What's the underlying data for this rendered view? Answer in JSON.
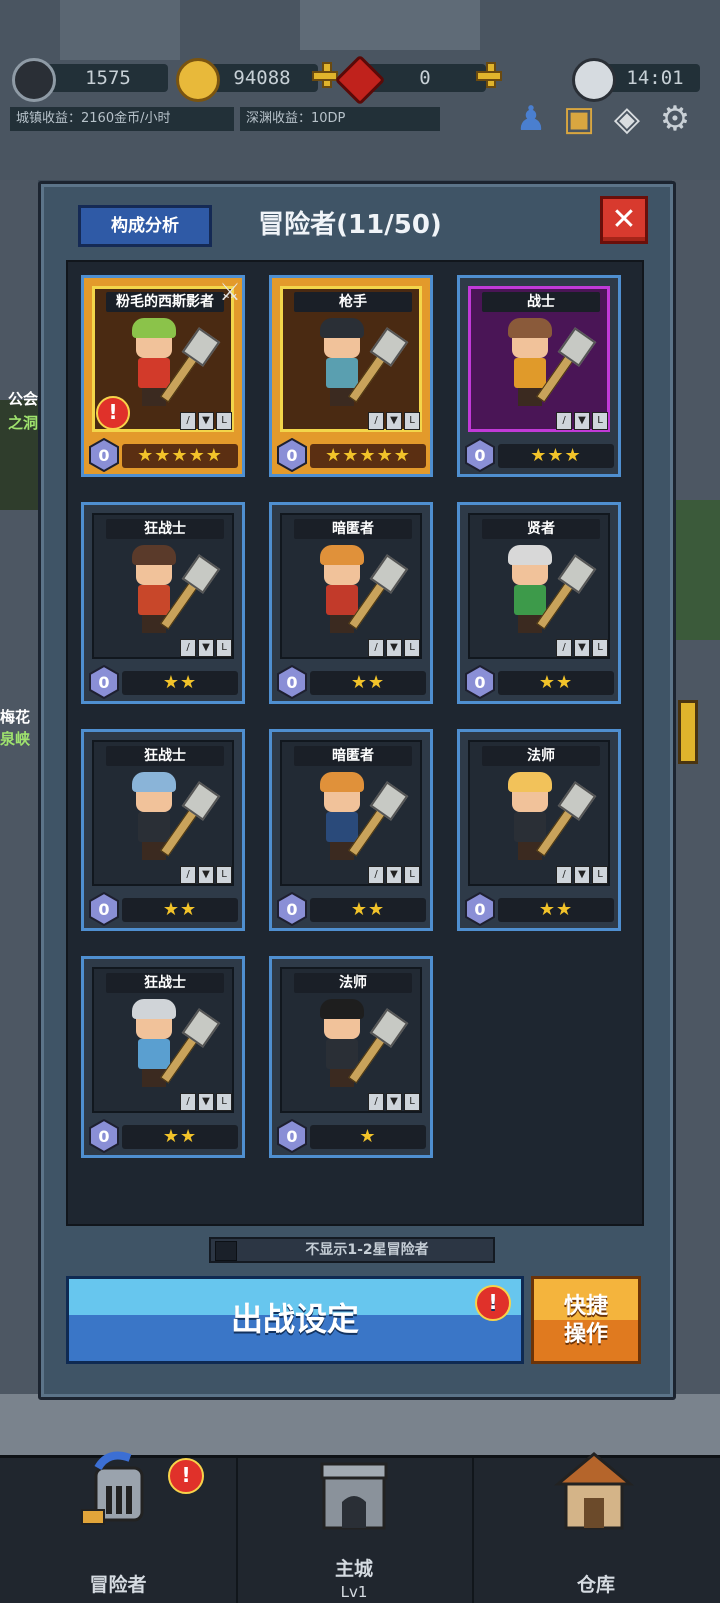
{
  "topbar": {
    "stamina_value": "1575",
    "gold_value": "94088",
    "gem_value": "0",
    "clock_value": "14:01",
    "town_income": "城镇收益：2160金币/小时",
    "abyss_income": "深渊收益：10DP"
  },
  "panel": {
    "analysis_label": "构成分析",
    "title": "冒险者(11/50)",
    "close_label": "✕"
  },
  "cards": [
    {
      "name": "粉毛的西斯影者",
      "stars": "★★★★★",
      "level": "0",
      "style": "gold"
    },
    {
      "name": "枪手",
      "stars": "★★★★★",
      "level": "0",
      "style": "gold"
    },
    {
      "name": "战士",
      "stars": "★★★",
      "level": "0",
      "style": "purple"
    },
    {
      "name": "狂战士",
      "stars": "★★",
      "level": "0",
      "style": "normal"
    },
    {
      "name": "暗匿者",
      "stars": "★★",
      "level": "0",
      "style": "normal"
    },
    {
      "name": "贤者",
      "stars": "★★",
      "level": "0",
      "style": "normal"
    },
    {
      "name": "狂战士",
      "stars": "★★",
      "level": "0",
      "style": "normal"
    },
    {
      "name": "暗匿者",
      "stars": "★★",
      "level": "0",
      "style": "normal"
    },
    {
      "name": "法师",
      "stars": "★★",
      "level": "0",
      "style": "normal"
    },
    {
      "name": "狂战士",
      "stars": "★★",
      "level": "0",
      "style": "normal"
    },
    {
      "name": "法师",
      "stars": "★",
      "level": "0",
      "style": "normal"
    }
  ],
  "filter": {
    "label": "不显示1-2星冒险者"
  },
  "buttons": {
    "battle_label": "出战设定",
    "quick_label_1": "快捷",
    "quick_label_2": "操作",
    "alert_glyph": "!"
  },
  "nav": {
    "adventurer": "冒险者",
    "main_city": "主城",
    "main_city_level": "Lv1",
    "warehouse": "仓库"
  },
  "side_labels": {
    "guild": "公会",
    "cave": "之洞",
    "plum": "梅花",
    "gorge": "泉峡"
  },
  "colors": {
    "card_border": "#4f8fd0",
    "gold_card": "#e39a2b",
    "purple_frame": "#c13ad8",
    "star": "#f2c32a",
    "battle_button": "#3a76c7",
    "quick_button": "#f4b43d",
    "close_button": "#d83a2e"
  }
}
